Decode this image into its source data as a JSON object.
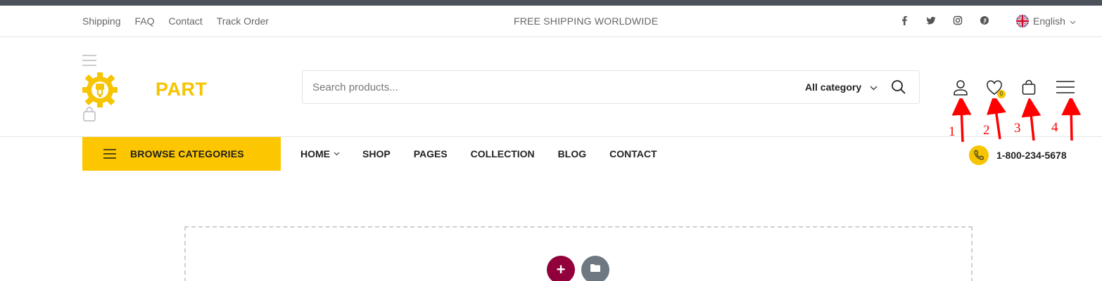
{
  "topbar": {
    "links": [
      "Shipping",
      "FAQ",
      "Contact",
      "Track Order"
    ],
    "promo": "FREE SHIPPING WORLDWIDE",
    "social_icons": [
      "facebook-icon",
      "twitter-icon",
      "instagram-icon",
      "pinterest-icon"
    ],
    "language": "English"
  },
  "header": {
    "logo_text": "PART",
    "search": {
      "placeholder": "Search products...",
      "category_label": "All category"
    },
    "icons": [
      "user-icon",
      "heart-icon",
      "bag-icon",
      "menu-icon"
    ],
    "wishlist_count": "0"
  },
  "nav": {
    "browse_label": "BROWSE CATEGORIES",
    "items": [
      "HOME",
      "SHOP",
      "PAGES",
      "COLLECTION",
      "BLOG",
      "CONTACT"
    ],
    "phone": "1-800-234-5678"
  },
  "annotations": {
    "labels": [
      "1",
      "2",
      "3",
      "4"
    ],
    "color": "#ff0000"
  },
  "editor": {
    "add_label": "+",
    "icons": [
      "plus-icon",
      "folder-icon"
    ],
    "add_color": "#92003b",
    "folder_color": "#6d7882"
  },
  "colors": {
    "accent": "#fcc700",
    "topstrip": "#4b5259"
  }
}
